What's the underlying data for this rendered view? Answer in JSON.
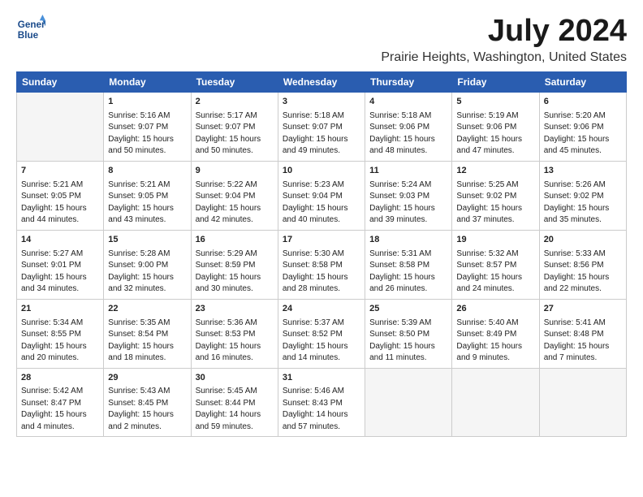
{
  "logo": {
    "line1": "General",
    "line2": "Blue"
  },
  "title": "July 2024",
  "subtitle": "Prairie Heights, Washington, United States",
  "headers": [
    "Sunday",
    "Monday",
    "Tuesday",
    "Wednesday",
    "Thursday",
    "Friday",
    "Saturday"
  ],
  "weeks": [
    [
      {
        "day": "",
        "content": ""
      },
      {
        "day": "1",
        "content": "Sunrise: 5:16 AM\nSunset: 9:07 PM\nDaylight: 15 hours\nand 50 minutes."
      },
      {
        "day": "2",
        "content": "Sunrise: 5:17 AM\nSunset: 9:07 PM\nDaylight: 15 hours\nand 50 minutes."
      },
      {
        "day": "3",
        "content": "Sunrise: 5:18 AM\nSunset: 9:07 PM\nDaylight: 15 hours\nand 49 minutes."
      },
      {
        "day": "4",
        "content": "Sunrise: 5:18 AM\nSunset: 9:06 PM\nDaylight: 15 hours\nand 48 minutes."
      },
      {
        "day": "5",
        "content": "Sunrise: 5:19 AM\nSunset: 9:06 PM\nDaylight: 15 hours\nand 47 minutes."
      },
      {
        "day": "6",
        "content": "Sunrise: 5:20 AM\nSunset: 9:06 PM\nDaylight: 15 hours\nand 45 minutes."
      }
    ],
    [
      {
        "day": "7",
        "content": "Sunrise: 5:21 AM\nSunset: 9:05 PM\nDaylight: 15 hours\nand 44 minutes."
      },
      {
        "day": "8",
        "content": "Sunrise: 5:21 AM\nSunset: 9:05 PM\nDaylight: 15 hours\nand 43 minutes."
      },
      {
        "day": "9",
        "content": "Sunrise: 5:22 AM\nSunset: 9:04 PM\nDaylight: 15 hours\nand 42 minutes."
      },
      {
        "day": "10",
        "content": "Sunrise: 5:23 AM\nSunset: 9:04 PM\nDaylight: 15 hours\nand 40 minutes."
      },
      {
        "day": "11",
        "content": "Sunrise: 5:24 AM\nSunset: 9:03 PM\nDaylight: 15 hours\nand 39 minutes."
      },
      {
        "day": "12",
        "content": "Sunrise: 5:25 AM\nSunset: 9:02 PM\nDaylight: 15 hours\nand 37 minutes."
      },
      {
        "day": "13",
        "content": "Sunrise: 5:26 AM\nSunset: 9:02 PM\nDaylight: 15 hours\nand 35 minutes."
      }
    ],
    [
      {
        "day": "14",
        "content": "Sunrise: 5:27 AM\nSunset: 9:01 PM\nDaylight: 15 hours\nand 34 minutes."
      },
      {
        "day": "15",
        "content": "Sunrise: 5:28 AM\nSunset: 9:00 PM\nDaylight: 15 hours\nand 32 minutes."
      },
      {
        "day": "16",
        "content": "Sunrise: 5:29 AM\nSunset: 8:59 PM\nDaylight: 15 hours\nand 30 minutes."
      },
      {
        "day": "17",
        "content": "Sunrise: 5:30 AM\nSunset: 8:58 PM\nDaylight: 15 hours\nand 28 minutes."
      },
      {
        "day": "18",
        "content": "Sunrise: 5:31 AM\nSunset: 8:58 PM\nDaylight: 15 hours\nand 26 minutes."
      },
      {
        "day": "19",
        "content": "Sunrise: 5:32 AM\nSunset: 8:57 PM\nDaylight: 15 hours\nand 24 minutes."
      },
      {
        "day": "20",
        "content": "Sunrise: 5:33 AM\nSunset: 8:56 PM\nDaylight: 15 hours\nand 22 minutes."
      }
    ],
    [
      {
        "day": "21",
        "content": "Sunrise: 5:34 AM\nSunset: 8:55 PM\nDaylight: 15 hours\nand 20 minutes."
      },
      {
        "day": "22",
        "content": "Sunrise: 5:35 AM\nSunset: 8:54 PM\nDaylight: 15 hours\nand 18 minutes."
      },
      {
        "day": "23",
        "content": "Sunrise: 5:36 AM\nSunset: 8:53 PM\nDaylight: 15 hours\nand 16 minutes."
      },
      {
        "day": "24",
        "content": "Sunrise: 5:37 AM\nSunset: 8:52 PM\nDaylight: 15 hours\nand 14 minutes."
      },
      {
        "day": "25",
        "content": "Sunrise: 5:39 AM\nSunset: 8:50 PM\nDaylight: 15 hours\nand 11 minutes."
      },
      {
        "day": "26",
        "content": "Sunrise: 5:40 AM\nSunset: 8:49 PM\nDaylight: 15 hours\nand 9 minutes."
      },
      {
        "day": "27",
        "content": "Sunrise: 5:41 AM\nSunset: 8:48 PM\nDaylight: 15 hours\nand 7 minutes."
      }
    ],
    [
      {
        "day": "28",
        "content": "Sunrise: 5:42 AM\nSunset: 8:47 PM\nDaylight: 15 hours\nand 4 minutes."
      },
      {
        "day": "29",
        "content": "Sunrise: 5:43 AM\nSunset: 8:45 PM\nDaylight: 15 hours\nand 2 minutes."
      },
      {
        "day": "30",
        "content": "Sunrise: 5:45 AM\nSunset: 8:44 PM\nDaylight: 14 hours\nand 59 minutes."
      },
      {
        "day": "31",
        "content": "Sunrise: 5:46 AM\nSunset: 8:43 PM\nDaylight: 14 hours\nand 57 minutes."
      },
      {
        "day": "",
        "content": ""
      },
      {
        "day": "",
        "content": ""
      },
      {
        "day": "",
        "content": ""
      }
    ]
  ]
}
